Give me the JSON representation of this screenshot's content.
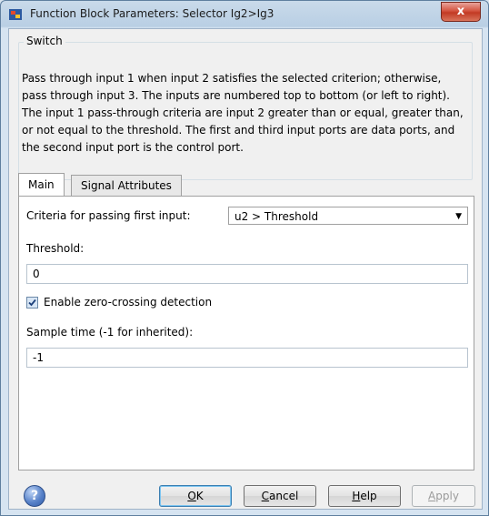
{
  "window": {
    "title": "Function Block Parameters: Selector Ig2>Ig3",
    "close_label": "x"
  },
  "block": {
    "type_label": "Switch",
    "description": "Pass through input 1 when input 2 satisfies the selected criterion; otherwise, pass through input 3.  The inputs are numbered top to bottom (or left to right). The input 1 pass-through criteria are input 2 greater than or equal, greater than, or not equal to the threshold.  The first and third input ports are data ports, and the second input port is the control port."
  },
  "tabs": [
    {
      "label": "Main",
      "active": true
    },
    {
      "label": "Signal Attributes",
      "active": false
    }
  ],
  "main": {
    "criteria_label": "Criteria for passing first input:",
    "criteria_value": "u2 > Threshold",
    "threshold_label": "Threshold:",
    "threshold_value": "0",
    "zero_crossing_label": "Enable zero-crossing detection",
    "zero_crossing_checked": true,
    "sample_time_label": "Sample time (-1 for inherited):",
    "sample_time_value": "-1"
  },
  "buttons": {
    "ok_prefix": "",
    "ok_mnemonic": "O",
    "ok_rest": "K",
    "cancel_mnemonic": "C",
    "cancel_rest": "ancel",
    "help_mnemonic": "H",
    "help_rest": "elp",
    "apply_mnemonic": "A",
    "apply_rest": "pply"
  },
  "icons": {
    "help": "help-icon",
    "window": "simulink-block-icon"
  }
}
